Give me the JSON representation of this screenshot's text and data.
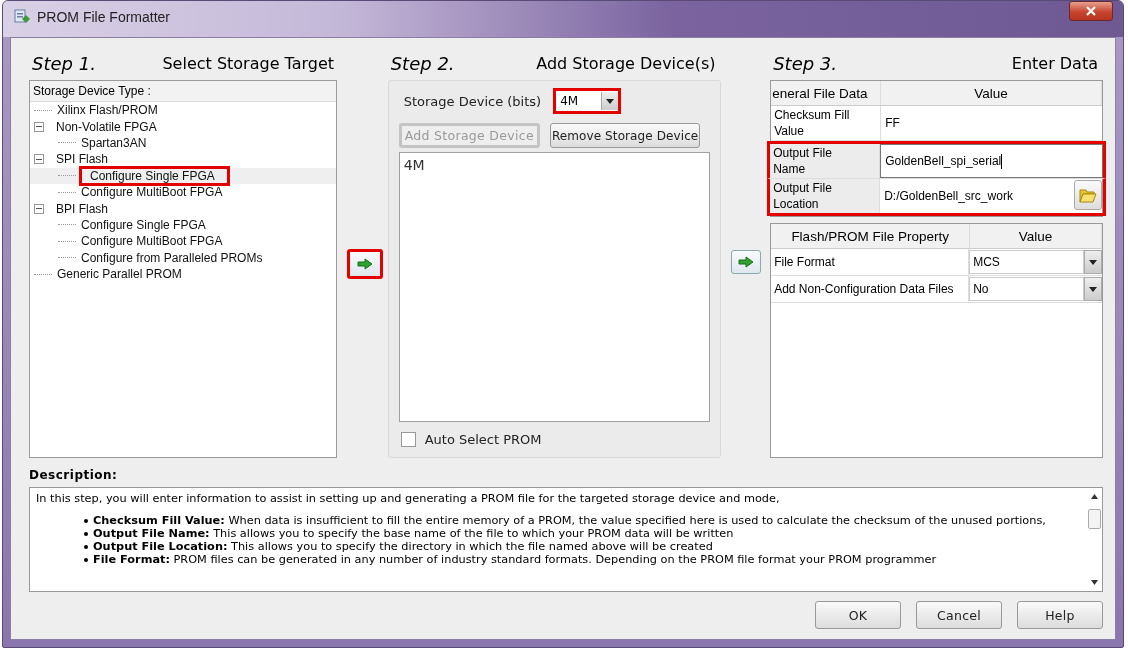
{
  "window": {
    "title": "PROM File Formatter"
  },
  "step1": {
    "step": "Step 1.",
    "title": "Select Storage Target",
    "tree_header": "Storage Device Type :",
    "tree": [
      {
        "label": "Xilinx Flash/PROM",
        "selected": false,
        "highlighted": false
      },
      {
        "label": "Non-Volatile FPGA",
        "selected": false,
        "highlighted": false,
        "expanded": true,
        "children": [
          {
            "label": "Spartan3AN",
            "selected": false,
            "highlighted": false
          }
        ]
      },
      {
        "label": "SPI Flash",
        "selected": false,
        "highlighted": false,
        "expanded": true,
        "children": [
          {
            "label": "Configure Single FPGA",
            "selected": true,
            "highlighted": true
          },
          {
            "label": "Configure MultiBoot FPGA",
            "selected": false,
            "highlighted": false
          }
        ]
      },
      {
        "label": "BPI Flash",
        "selected": false,
        "highlighted": false,
        "expanded": true,
        "children": [
          {
            "label": "Configure Single FPGA",
            "selected": false,
            "highlighted": false
          },
          {
            "label": "Configure MultiBoot FPGA",
            "selected": false,
            "highlighted": false
          },
          {
            "label": "Configure from Paralleled PROMs",
            "selected": false,
            "highlighted": false
          }
        ]
      },
      {
        "label": "Generic Parallel PROM",
        "selected": false,
        "highlighted": false
      }
    ],
    "next_button": {
      "highlighted": true
    }
  },
  "step2": {
    "step": "Step 2.",
    "title": "Add Storage Device(s)",
    "size_label": "Storage Device (bits)",
    "size_value": "4M",
    "size_highlighted": true,
    "add_button": {
      "label": "Add Storage Device",
      "disabled": true,
      "highlighted": true
    },
    "remove_button": {
      "label": "Remove Storage Device",
      "disabled": false,
      "highlighted": false
    },
    "devices": [
      "4M"
    ],
    "auto_select": {
      "label": "Auto Select PROM",
      "checked": false
    },
    "next_button": {
      "highlighted": false
    }
  },
  "step3": {
    "step": "Step 3.",
    "title": "Enter Data",
    "general": {
      "columns": [
        "eneral File Data",
        "Value"
      ],
      "rows": [
        {
          "kind": "text",
          "name": "Checksum Fill Value",
          "value": "FF",
          "highlighted": false
        },
        {
          "kind": "input",
          "name": "Output File Name",
          "value": "GoldenBell_spi_serial",
          "highlighted": true
        },
        {
          "kind": "browse",
          "name": "Output File Location",
          "value": "D:/GoldenBell_src_work",
          "highlighted": true
        }
      ]
    },
    "properties": {
      "columns": [
        "Flash/PROM File Property",
        "Value"
      ],
      "rows": [
        {
          "kind": "dropdown",
          "name": "File Format",
          "value": "MCS"
        },
        {
          "kind": "dropdown",
          "name": "Add Non-Configuration Data Files",
          "value": "No"
        }
      ]
    }
  },
  "description": {
    "label": "Description:",
    "intro": "In this step, you will enter information to assist in setting up and generating a PROM file for the targeted storage device and mode,",
    "bullets": [
      "**Checksum Fill Value:** When data is insufficient to fill the entire memory of a PROM, the value specified here is used to calculate the checksum of the unused portions,",
      "**Output File Name:** This allows you to specify the base name of the file to which your PROM data will be written",
      "**Output File Location:** This allows you to specify the directory in which the file named above will be created",
      "**File Format:** PROM files can be generated in any number of industry standard formats. Depending on the PROM file format your PROM programmer"
    ]
  },
  "buttons": [
    "OK",
    "Cancel",
    "Help"
  ]
}
